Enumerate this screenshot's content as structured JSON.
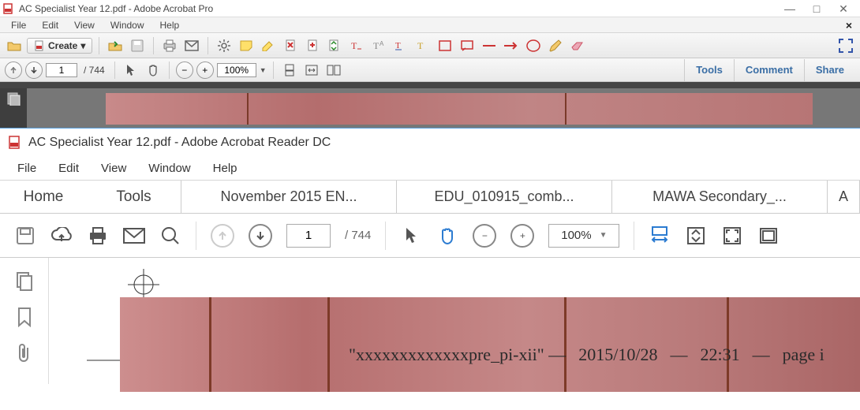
{
  "windowA": {
    "title": "AC Specialist Year 12.pdf - Adobe Acrobat Pro",
    "menu": [
      "File",
      "Edit",
      "View",
      "Window",
      "Help"
    ],
    "create_label": "Create",
    "page_current": "1",
    "page_total": "/ 744",
    "zoom": "100%",
    "right_links": [
      "Tools",
      "Comment",
      "Share"
    ]
  },
  "windowB": {
    "title": "AC Specialist Year 12.pdf - Adobe Acrobat Reader DC",
    "menu": [
      "File",
      "Edit",
      "View",
      "Window",
      "Help"
    ],
    "tabs": {
      "home": "Home",
      "tools": "Tools",
      "docs": [
        "November 2015 EN...",
        "EDU_010915_comb...",
        "MAWA Secondary_...",
        "A"
      ]
    },
    "page_current": "1",
    "page_total": "/ 744",
    "zoom": "100%",
    "doc_overlay": {
      "text": "\"xxxxxxxxxxxxxpre_pi-xii\" — ",
      "date": "2015/10/28",
      "sep1": " — ",
      "time": "22:31",
      "sep2": " — ",
      "page": "page i"
    }
  }
}
